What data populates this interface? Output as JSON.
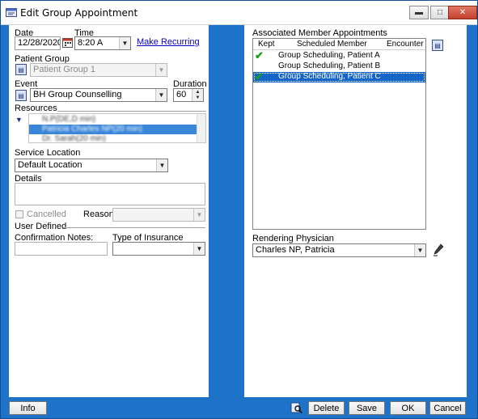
{
  "window": {
    "title": "Edit Group Appointment"
  },
  "titlebar_buttons": {
    "minimize": "▬",
    "maximize": "□",
    "close": "✕"
  },
  "left": {
    "date_label": "Date",
    "date_value": "12/28/2020",
    "time_label": "Time",
    "time_value": "8:20 A",
    "make_recurring": "Make Recurring",
    "patient_group_label": "Patient Group",
    "patient_group_value": "Patient Group 1",
    "event_label": "Event",
    "event_value": "BH Group Counselling",
    "duration_label": "Duration",
    "duration_value": "60",
    "resources_label": "Resources",
    "resources": [
      "N.P(DE,D min)",
      "Patricia Charles NP(20 min)",
      "Dr. Sarah(20 min)"
    ],
    "service_location_label": "Service Location",
    "service_location_value": "Default Location",
    "details_label": "Details",
    "cancelled_label": "Cancelled",
    "reason_label": "Reason:",
    "user_defined_label": "User Defined",
    "confirmation_notes_label": "Confirmation Notes:",
    "insurance_label": "Type of Insurance"
  },
  "right": {
    "assoc_label": "Associated Member Appointments",
    "columns": [
      "Kept",
      "Scheduled Member",
      "Encounter"
    ],
    "rows": [
      {
        "kept": true,
        "member": "Group Scheduling, Patient A"
      },
      {
        "kept": false,
        "member": "Group Scheduling, Patient B"
      },
      {
        "kept": true,
        "member": "Group Scheduling, Patient C"
      }
    ],
    "rendering_label": "Rendering Physician",
    "rendering_value": "Charles NP, Patricia"
  },
  "buttons": {
    "info": "Info",
    "delete": "Delete",
    "save": "Save",
    "ok": "OK",
    "cancel": "Cancel"
  }
}
